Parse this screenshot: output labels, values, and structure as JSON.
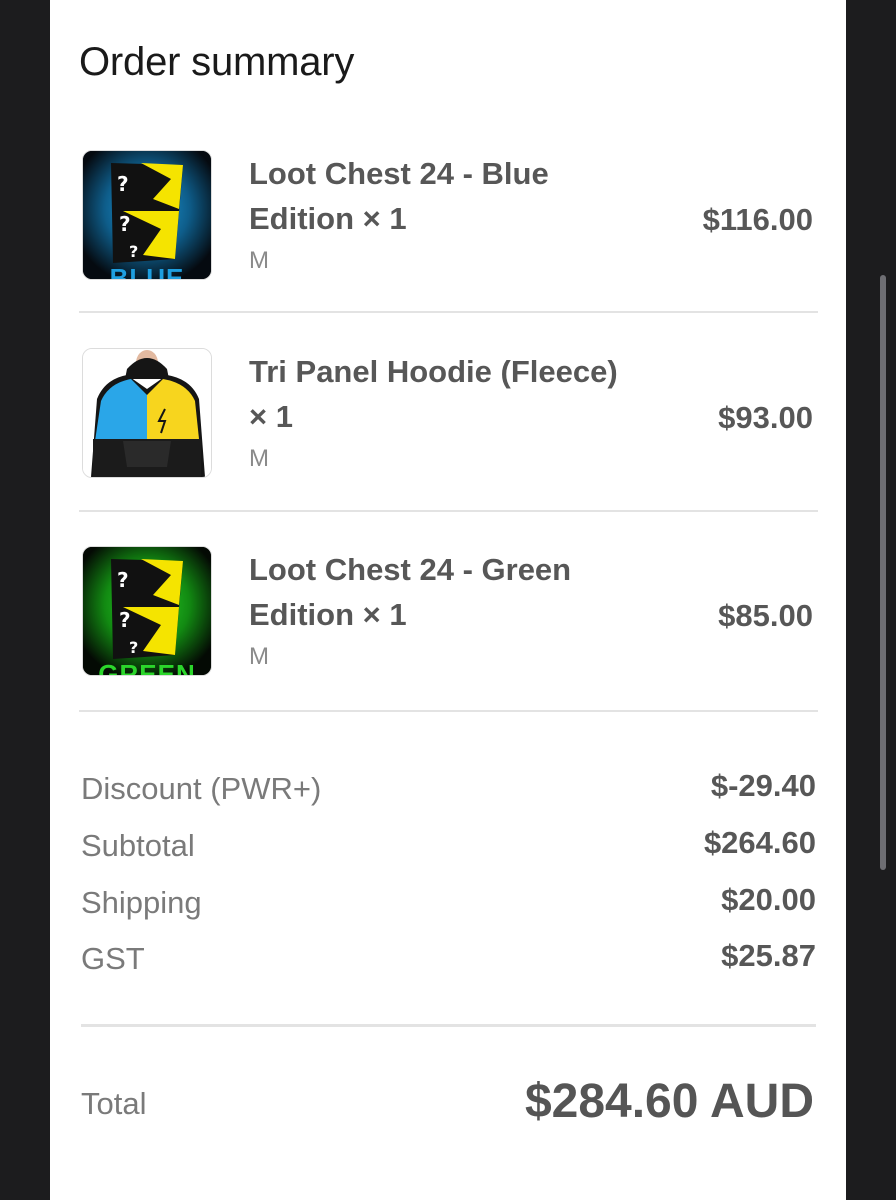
{
  "header": {
    "title": "Order summary"
  },
  "items": [
    {
      "name": "Loot Chest 24 - Blue Edition × 1",
      "variant": "M",
      "price": "$116.00",
      "image_icon": "loot-chest-blue-image",
      "image_caption": "BLUE",
      "accent": "#1e9fe0"
    },
    {
      "name": "Tri Panel Hoodie (Fleece) × 1",
      "variant": "M",
      "price": "$93.00",
      "image_icon": "hoodie-image"
    },
    {
      "name": "Loot Chest 24 - Green Edition × 1",
      "variant": "M",
      "price": "$85.00",
      "image_icon": "loot-chest-green-image",
      "image_caption": "GREEN",
      "accent": "#2bd62b"
    }
  ],
  "summary": {
    "discount": {
      "label": "Discount (PWR+)",
      "value": "$-29.40"
    },
    "subtotal": {
      "label": "Subtotal",
      "value": "$264.60"
    },
    "shipping": {
      "label": "Shipping",
      "value": "$20.00"
    },
    "gst": {
      "label": "GST",
      "value": "$25.87"
    }
  },
  "total": {
    "label": "Total",
    "value": "$284.60 AUD"
  },
  "colors": {
    "bolt_yellow": "#f5e400",
    "hoodie_blue": "#2aa6e8",
    "hoodie_yellow": "#f7d51e"
  }
}
